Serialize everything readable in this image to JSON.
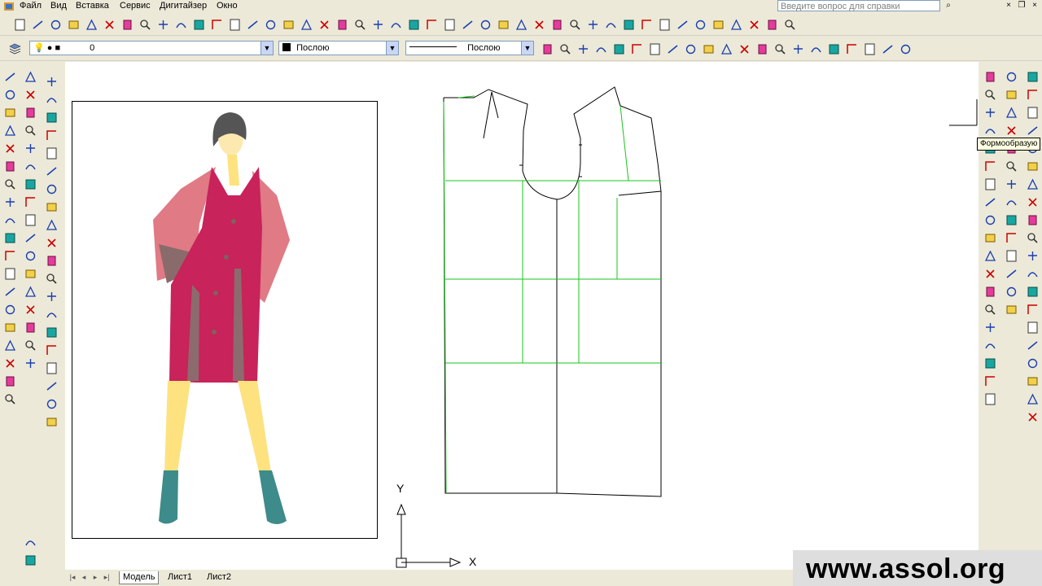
{
  "menu": {
    "items": [
      "Файл",
      "Вид",
      "Вставка",
      "Сервис",
      "Дигитайзер",
      "Окно"
    ],
    "help_placeholder": "Введите вопрос для справки"
  },
  "layers_toolbar": {
    "layer_value": "0",
    "color_value": "Послою",
    "linetype_value": "Послою"
  },
  "tooltip": "Формообразую",
  "axes": {
    "y_label": "Y",
    "x_label": "X"
  },
  "tabs": [
    "Модель",
    "Лист1",
    "Лист2"
  ],
  "active_tab": "Модель",
  "watermark": "www.assol.org",
  "colors": {
    "pattern_line": "#00cc00",
    "coat": "#c8235a",
    "sleeve": "#e07a85",
    "tights": "#fde27f",
    "boots": "#3d8b8a"
  }
}
